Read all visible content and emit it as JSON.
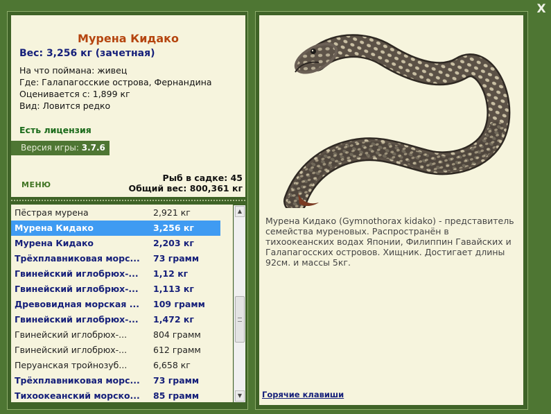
{
  "close_label": "X",
  "info": {
    "title": "Мурена Кидако",
    "weight": "Вес: 3,256 кг (зачетная)",
    "bait": "На что поймана: живец",
    "location": "Где: Галапагосские острова, Фернандина",
    "valued_from": "Оценивается с: 1,899 кг",
    "kind": "Вид: Ловится редко",
    "license": "Есть лицензия",
    "version_label": "Версия игры:",
    "version_value": "3.7.6",
    "menu_label": "МЕНЮ",
    "cage_count": "Рыб в садке: 45",
    "total_weight": "Общий вес: 800,361 кг"
  },
  "fish_list": [
    {
      "name": "Пёстрая мурена",
      "weight": "2,921 кг",
      "style": "plain"
    },
    {
      "name": "Мурена Кидако",
      "weight": "3,256 кг",
      "style": "selected"
    },
    {
      "name": "Мурена Кидако",
      "weight": "2,203 кг",
      "style": "bold"
    },
    {
      "name": "Трёхплавниковая морс...",
      "weight": "73 грамм",
      "style": "bold"
    },
    {
      "name": "Гвинейский иглобрюх-...",
      "weight": "1,12 кг",
      "style": "bold"
    },
    {
      "name": "Гвинейский иглобрюх-...",
      "weight": "1,113 кг",
      "style": "bold"
    },
    {
      "name": "Древовидная морская ...",
      "weight": "109 грамм",
      "style": "bold"
    },
    {
      "name": "Гвинейский иглобрюх-...",
      "weight": "1,472 кг",
      "style": "bold"
    },
    {
      "name": "Гвинейский иглобрюх-...",
      "weight": "804 грамм",
      "style": "plain"
    },
    {
      "name": "Гвинейский иглобрюх-...",
      "weight": "612 грамм",
      "style": "plain"
    },
    {
      "name": "Перуанская тройнозуб...",
      "weight": "6,658 кг",
      "style": "plain"
    },
    {
      "name": "Трёхплавниковая морс...",
      "weight": "73 грамм",
      "style": "bold"
    },
    {
      "name": "Тихоокеанский морско...",
      "weight": "85 грамм",
      "style": "bold"
    }
  ],
  "description": "Мурена Кидако (Gymnothorax kidako) - представитель семейства муреновых. Распространён в тихоокеанских водах Японии, Филиппин Гавайских и Галапагосских островов. Хищник. Достигает длины 92см. и массы 5кг.",
  "hotkeys_label": "Горячие клавиши",
  "colors": {
    "background": "#4e7633",
    "panel": "#f6f4dd",
    "title": "#b5450f",
    "accent_blue": "#16207a",
    "selection": "#3f9bf2",
    "license_green": "#1b6b1b"
  }
}
